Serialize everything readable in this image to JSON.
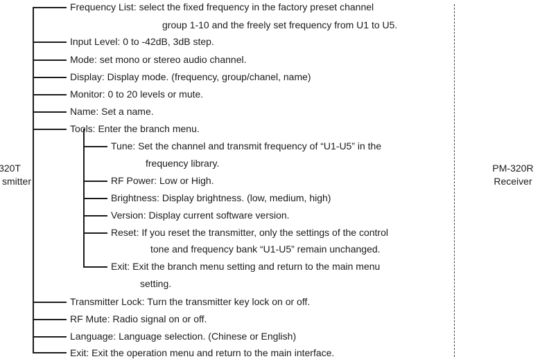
{
  "transmitter": {
    "line1": "320T",
    "line2": "smitter"
  },
  "receiver": {
    "line1": "PM-320R",
    "line2": "Receiver"
  },
  "main_menu": [
    {
      "line1": "Frequency List: select the fixed frequency in the factory preset channel",
      "line2": "group 1-10 and the freely set frequency from U1 to U5."
    },
    {
      "line1": "Input Level: 0 to -42dB, 3dB step."
    },
    {
      "line1": "Mode: set mono or stereo audio channel."
    },
    {
      "line1": "Display: Display mode. (frequency, group/chanel, name)"
    },
    {
      "line1": "Monitor: 0 to 20 levels or mute."
    },
    {
      "line1": "Name: Set a name."
    },
    {
      "line1": "Tools: Enter the branch menu."
    },
    {
      "line1": "Transmitter Lock: Turn the transmitter key lock on or off."
    },
    {
      "line1": "RF Mute: Radio signal on or off."
    },
    {
      "line1": "Language: Language selection. (Chinese or English)"
    },
    {
      "line1": "Exit: Exit the operation menu and return to the main interface."
    }
  ],
  "tools_menu": [
    {
      "line1": "Tune: Set the channel and transmit frequency of “U1-U5” in the",
      "line2": "frequency library."
    },
    {
      "line1": "RF Power: Low or High."
    },
    {
      "line1": "Brightness: Display brightness. (low, medium, high)"
    },
    {
      "line1": "Version: Display current software version."
    },
    {
      "line1": "Reset: If you reset the transmitter, only the settings of the control",
      "line2": "tone and frequency bank “U1-U5” remain unchanged."
    },
    {
      "line1": "Exit: Exit the branch menu setting and return to the main menu",
      "line2": "setting."
    }
  ]
}
